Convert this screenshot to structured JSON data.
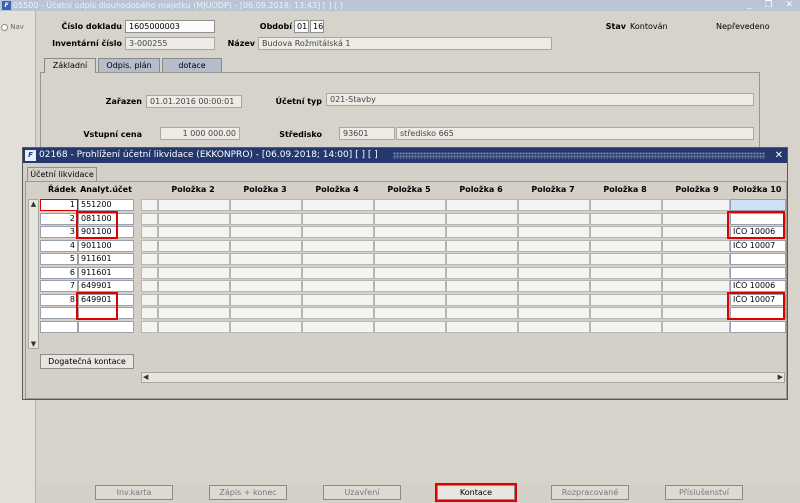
{
  "outer_window": {
    "title": "05500 - Účetní odpis dlouhodobého majetku (MJUODP) - [06.09.2018; 13:43]  [ ] [ ]",
    "controls": "_ ❐ ✕"
  },
  "nav": {
    "label": "Nav"
  },
  "header": {
    "cislo_dokladu_label": "Číslo dokladu",
    "cislo_dokladu_value": "1605000003",
    "obdobi_label": "Období",
    "obdobi_month": "01",
    "obdobi_year": "16",
    "stav_label": "Stav",
    "stav_value": "Kontován",
    "stav_value2": "Nepřevedeno",
    "inventarni_cislo_label": "Inventární číslo",
    "inventarni_cislo_value": "3-000255",
    "nazev_label": "Název",
    "nazev_value": "Budova Rožmitálská 1"
  },
  "tabs": [
    {
      "label": "Základní"
    },
    {
      "label": "Odpis. plán"
    },
    {
      "label": "dotace"
    }
  ],
  "zakladni": {
    "zarazen_label": "Zařazen",
    "zarazen_value": "01.01.2016 00:00:01",
    "ucetni_typ_label": "Účetní typ",
    "ucetni_typ_value": "021-Stavby",
    "vstupni_cena_label": "Vstupní cena",
    "vstupni_cena_value": "1 000 000.00",
    "stredisko_label": "Středisko",
    "stredisko_code": "93601",
    "stredisko_name": "středisko 665"
  },
  "inner_window": {
    "title": "02168 - Prohlížení účetní likvidace (EKKONPRO) - [06.09.2018; 14:00]  [ ] [ ]",
    "close": "✕",
    "subtab": "Účetní likvidace",
    "columns": [
      "Řádek",
      "Analyt.účet",
      "Položka 2",
      "Položka 3",
      "Položka 4",
      "Položka 5",
      "Položka 6",
      "Položka 7",
      "Položka 8",
      "Položka 9",
      "Položka 10"
    ],
    "rows": [
      {
        "radek": "1",
        "ucet": "551200",
        "p10": ""
      },
      {
        "radek": "2",
        "ucet": "081100",
        "p10": ""
      },
      {
        "radek": "3",
        "ucet": "901100",
        "p10": "IČO 10006"
      },
      {
        "radek": "4",
        "ucet": "901100",
        "p10": "IČO 10007"
      },
      {
        "radek": "5",
        "ucet": "911601",
        "p10": ""
      },
      {
        "radek": "6",
        "ucet": "911601",
        "p10": ""
      },
      {
        "radek": "7",
        "ucet": "649901",
        "p10": "IČO 10006"
      },
      {
        "radek": "8",
        "ucet": "649901",
        "p10": "IČO 10007"
      },
      {
        "radek": "",
        "ucet": "",
        "p10": ""
      },
      {
        "radek": "",
        "ucet": "",
        "p10": ""
      }
    ],
    "dogatecna_button": "Dogatečná kontace"
  },
  "bottom_buttons": [
    {
      "label": "Inv.karta"
    },
    {
      "label": "Zápis + konec"
    },
    {
      "label": "Uzavření"
    },
    {
      "label": "Kontace"
    },
    {
      "label": "Rozpracované"
    },
    {
      "label": "Příslušenství"
    }
  ],
  "colors": {
    "highlight": "#e00000",
    "inner_title_bg": "#24386e",
    "tab_inactive": "#b5bccc"
  }
}
